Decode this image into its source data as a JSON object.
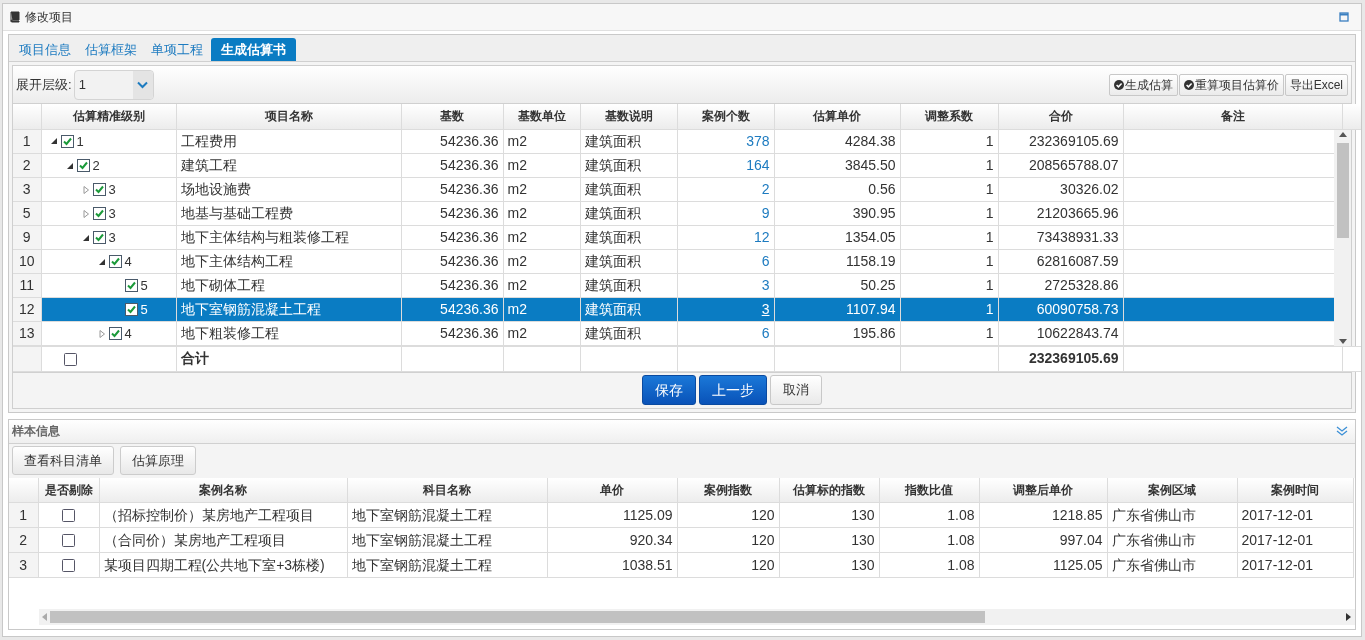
{
  "window": {
    "title": "修改项目"
  },
  "tabs": [
    {
      "label": "项目信息",
      "selected": false
    },
    {
      "label": "估算框架",
      "selected": false
    },
    {
      "label": "单项工程",
      "selected": false
    },
    {
      "label": "生成估算书",
      "selected": true
    }
  ],
  "toolbar": {
    "expand_label": "展开层级:",
    "expand_level": "1",
    "buttons": [
      "生成估算",
      "重算项目估算价",
      "导出Excel"
    ]
  },
  "tree_table": {
    "columns": [
      "估算精准级别",
      "项目名称",
      "基数",
      "基数单位",
      "基数说明",
      "案例个数",
      "估算单价",
      "调整系数",
      "合价",
      "备注"
    ],
    "rows": [
      {
        "row": "1",
        "level": "1",
        "name": "工程费用",
        "base": "54236.36",
        "unit": "m2",
        "desc": "建筑面积",
        "count": "378",
        "price": "4284.38",
        "coef": "1",
        "total": "232369105.69",
        "checked": true,
        "selected": false,
        "expanded": true,
        "children": [
          {
            "row": "2",
            "level": "2",
            "name": "建筑工程",
            "base": "54236.36",
            "unit": "m2",
            "desc": "建筑面积",
            "count": "164",
            "price": "3845.50",
            "coef": "1",
            "total": "208565788.07",
            "checked": true,
            "selected": false,
            "expanded": true,
            "children": [
              {
                "row": "3",
                "level": "3",
                "name": "场地设施费",
                "base": "54236.36",
                "unit": "m2",
                "desc": "建筑面积",
                "count": "2",
                "price": "0.56",
                "coef": "1",
                "total": "30326.02",
                "checked": true,
                "selected": false,
                "expanded": false
              },
              {
                "row": "5",
                "level": "3",
                "name": "地基与基础工程费",
                "base": "54236.36",
                "unit": "m2",
                "desc": "建筑面积",
                "count": "9",
                "price": "390.95",
                "coef": "1",
                "total": "21203665.96",
                "checked": true,
                "selected": false,
                "expanded": false
              },
              {
                "row": "9",
                "level": "3",
                "name": "地下主体结构与粗装修工程",
                "base": "54236.36",
                "unit": "m2",
                "desc": "建筑面积",
                "count": "12",
                "price": "1354.05",
                "coef": "1",
                "total": "73438931.33",
                "checked": true,
                "selected": false,
                "expanded": true,
                "children": [
                  {
                    "row": "10",
                    "level": "4",
                    "name": "地下主体结构工程",
                    "base": "54236.36",
                    "unit": "m2",
                    "desc": "建筑面积",
                    "count": "6",
                    "price": "1158.19",
                    "coef": "1",
                    "total": "62816087.59",
                    "checked": true,
                    "selected": false,
                    "expanded": true,
                    "children": [
                      {
                        "row": "11",
                        "level": "5",
                        "name": "地下砌体工程",
                        "base": "54236.36",
                        "unit": "m2",
                        "desc": "建筑面积",
                        "count": "3",
                        "price": "50.25",
                        "coef": "1",
                        "total": "2725328.86",
                        "checked": true,
                        "selected": false
                      },
                      {
                        "row": "12",
                        "level": "5",
                        "name": "地下室钢筋混凝土工程",
                        "base": "54236.36",
                        "unit": "m2",
                        "desc": "建筑面积",
                        "count": "3",
                        "price": "1107.94",
                        "coef": "1",
                        "total": "60090758.73",
                        "checked": true,
                        "selected": true
                      }
                    ]
                  },
                  {
                    "row": "13",
                    "level": "4",
                    "name": "地下粗装修工程",
                    "base": "54236.36",
                    "unit": "m2",
                    "desc": "建筑面积",
                    "count": "6",
                    "price": "195.86",
                    "coef": "1",
                    "total": "10622843.74",
                    "checked": true,
                    "selected": false,
                    "expanded": false
                  }
                ]
              }
            ]
          }
        ]
      }
    ],
    "footer": {
      "checked": false,
      "label": "合计",
      "total": "232369105.69"
    }
  },
  "actions": [
    {
      "label": "保存",
      "kind": "primary"
    },
    {
      "label": "上一步",
      "kind": "primary"
    },
    {
      "label": "取消",
      "kind": "plain"
    }
  ],
  "sample_panel": {
    "title": "样本信息",
    "buttons": [
      "查看科目清单",
      "估算原理"
    ],
    "columns": [
      "是否剔除",
      "案例名称",
      "科目名称",
      "单价",
      "案例指数",
      "估算标的指数",
      "指数比值",
      "调整后单价",
      "案例区域",
      "案例时间"
    ],
    "rows": [
      {
        "row": "1",
        "excluded": false,
        "case": "（招标控制价）某房地产工程项目",
        "item": "地下室钢筋混凝土工程",
        "price": "1125.09",
        "case_index": "120",
        "target_index": "130",
        "ratio": "1.08",
        "adjusted": "1218.85",
        "region": "广东省佛山市",
        "date": "2017-12-01"
      },
      {
        "row": "2",
        "excluded": false,
        "case": "（合同价）某房地产工程项目",
        "item": "地下室钢筋混凝土工程",
        "price": "920.34",
        "case_index": "120",
        "target_index": "130",
        "ratio": "1.08",
        "adjusted": "997.04",
        "region": "广东省佛山市",
        "date": "2017-12-01"
      },
      {
        "row": "3",
        "excluded": false,
        "case": "某项目四期工程(公共地下室+3栋楼)",
        "item": "地下室钢筋混凝土工程",
        "price": "1038.51",
        "case_index": "120",
        "target_index": "130",
        "ratio": "1.08",
        "adjusted": "1125.05",
        "region": "广东省佛山市",
        "date": "2017-12-01"
      }
    ]
  }
}
